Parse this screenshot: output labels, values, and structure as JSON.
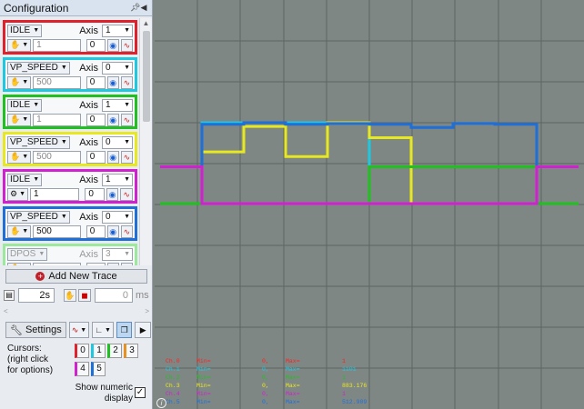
{
  "panel": {
    "title": "Configuration",
    "pin_icon": "pin-icon",
    "close_icon": "triangle-left-icon"
  },
  "traces": [
    {
      "type": "IDLE",
      "axis_label": "Axis",
      "axis": "1",
      "param": "1",
      "num": "0",
      "color": "#e0202a",
      "param_active": false
    },
    {
      "type": "VP_SPEED",
      "axis_label": "Axis",
      "axis": "0",
      "param": "500",
      "num": "0",
      "color": "#1ec8e0",
      "param_active": false
    },
    {
      "type": "IDLE",
      "axis_label": "Axis",
      "axis": "1",
      "param": "1",
      "num": "0",
      "color": "#20c020",
      "param_active": false
    },
    {
      "type": "VP_SPEED",
      "axis_label": "Axis",
      "axis": "0",
      "param": "500",
      "num": "0",
      "color": "#e8e820",
      "param_active": false
    },
    {
      "type": "IDLE",
      "axis_label": "Axis",
      "axis": "1",
      "param": "1",
      "num": "0",
      "color": "#d020d0",
      "param_active": true
    },
    {
      "type": "VP_SPEED",
      "axis_label": "Axis",
      "axis": "0",
      "param": "500",
      "num": "0",
      "color": "#1e6fd8",
      "param_active": true
    },
    {
      "type": "DPOS",
      "axis_label": "Axis",
      "axis": "3",
      "param": "",
      "num": "",
      "color": "#9ce89c",
      "param_active": false
    }
  ],
  "add_trace_label": "Add New Trace",
  "timebase": "2s",
  "delay": "0",
  "delay_unit": "ms",
  "slider_left": "<",
  "slider_right": ">",
  "settings_label": "Settings",
  "cursors": {
    "line1": "Cursors:",
    "line2": "(right click",
    "line3": "for options)",
    "buttons": [
      "0",
      "1",
      "2",
      "3",
      "4",
      "5"
    ],
    "colors": [
      "#e0202a",
      "#1ec8e0",
      "#20c020",
      "#e89020",
      "#d020d0",
      "#1e6fd8"
    ]
  },
  "show_numeric": {
    "line1": "Show numeric",
    "line2": "display",
    "checked": "✓"
  },
  "readout": [
    {
      "ch": "Ch.0",
      "min": "Min=",
      "minv": "0,",
      "max": "Max=",
      "maxv": "1",
      "color": "#ff2020"
    },
    {
      "ch": "Ch.1",
      "min": "Min=",
      "minv": "0,",
      "max": "Max=",
      "maxv": "1101",
      "color": "#1ec8e0"
    },
    {
      "ch": "Ch.2",
      "min": "Min=",
      "minv": "0,",
      "max": "Max=",
      "maxv": "1",
      "color": "#20c020"
    },
    {
      "ch": "Ch.3",
      "min": "Min=",
      "minv": "0,",
      "max": "Max=",
      "maxv": "883.176",
      "color": "#e8e820"
    },
    {
      "ch": "Ch.4",
      "min": "Min=",
      "minv": "0,",
      "max": "Max=",
      "maxv": "1",
      "color": "#d020d0"
    },
    {
      "ch": "Ch.5",
      "min": "Min=",
      "minv": "0,",
      "max": "Max=",
      "maxv": "512.909",
      "color": "#1e6fd8"
    }
  ],
  "chart_data": {
    "type": "line",
    "grid": true,
    "x": [
      0,
      1,
      2,
      3,
      4,
      5,
      6,
      7,
      8,
      9,
      10
    ],
    "series": [
      {
        "color": "#1ec8e0",
        "values": [
          0,
          1101,
          1101,
          1101,
          1101,
          0,
          0,
          0,
          0,
          0,
          0
        ]
      },
      {
        "color": "#e8e820",
        "values": [
          0,
          550,
          820,
          500,
          860,
          700,
          0,
          0,
          0,
          0,
          0
        ]
      },
      {
        "color": "#1e6fd8",
        "values": [
          0,
          500,
          510,
          500,
          505,
          500,
          480,
          505,
          500,
          0,
          0
        ]
      },
      {
        "color": "#20c020",
        "values": [
          0,
          0,
          0,
          0,
          0,
          1,
          1,
          1,
          1,
          0,
          0
        ]
      },
      {
        "color": "#d020d0",
        "values": [
          1,
          0,
          0,
          0,
          0,
          0,
          0,
          0,
          0,
          1,
          1
        ]
      }
    ]
  }
}
